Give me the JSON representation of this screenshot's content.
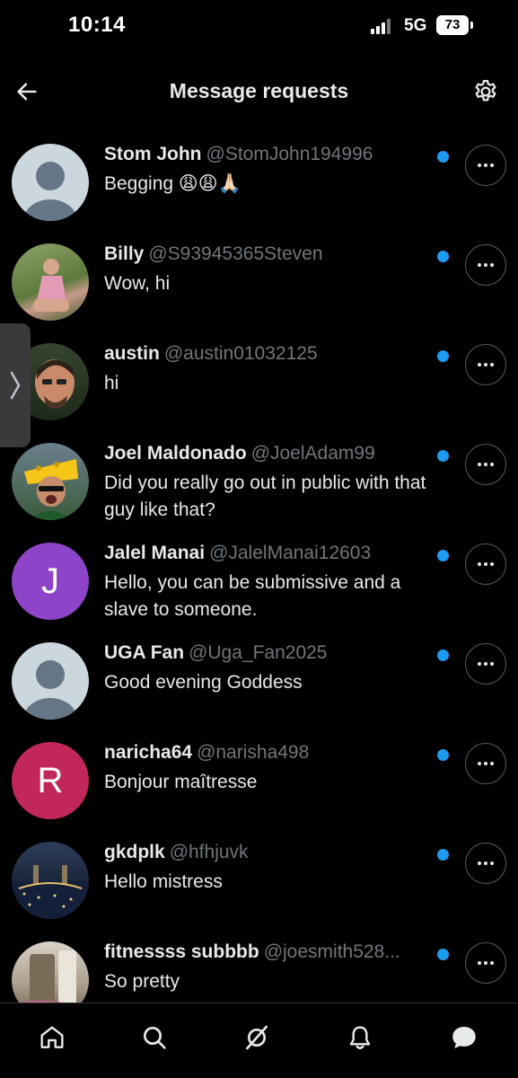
{
  "status_bar": {
    "time": "10:14",
    "network": "5G",
    "battery": "73"
  },
  "header": {
    "title": "Message requests"
  },
  "colors": {
    "background": "#000000",
    "accent": "#1d9bf0",
    "muted": "#71767b",
    "avatar_purple": "#8e44c9",
    "avatar_red": "#c2275a"
  },
  "requests": [
    {
      "name": "Stom John",
      "handle": "@StomJohn194996",
      "preview": "Begging 😩😩🙏🏻",
      "avatar": "default-avatar-icon",
      "unread": true
    },
    {
      "name": "Billy",
      "handle": "@S93945365Steven",
      "preview": "Wow, hi",
      "avatar": "photo-avatar",
      "unread": true
    },
    {
      "name": "austin",
      "handle": "@austin01032125",
      "preview": "hi",
      "avatar": "photo-avatar",
      "unread": true
    },
    {
      "name": "Joel Maldonado",
      "handle": "@JoelAdam99",
      "preview": "Did you really go out in public with that guy like that?",
      "avatar": "photo-avatar",
      "unread": true
    },
    {
      "name": "Jalel Manai",
      "handle": "@JalelManai12603",
      "preview": "Hello, you can be submissive and a slave to someone.",
      "avatar": "initial-avatar",
      "initial": "J",
      "unread": true
    },
    {
      "name": "UGA Fan",
      "handle": "@Uga_Fan2025",
      "preview": "Good evening Goddess",
      "avatar": "default-avatar-icon",
      "unread": true
    },
    {
      "name": "naricha64",
      "handle": "@narisha498",
      "preview": "Bonjour maîtresse",
      "avatar": "initial-avatar",
      "initial": "R",
      "unread": true
    },
    {
      "name": "gkdplk",
      "handle": "@hfhjuvk",
      "preview": "Hello mistress",
      "avatar": "photo-avatar",
      "unread": true
    },
    {
      "name": "fitnessss subbbb",
      "handle": "@joesmith528...",
      "preview": "So pretty",
      "avatar": "photo-avatar",
      "unread": true
    }
  ],
  "nav": [
    "home-icon",
    "search-icon",
    "grok-icon",
    "notifications-icon",
    "messages-icon"
  ]
}
